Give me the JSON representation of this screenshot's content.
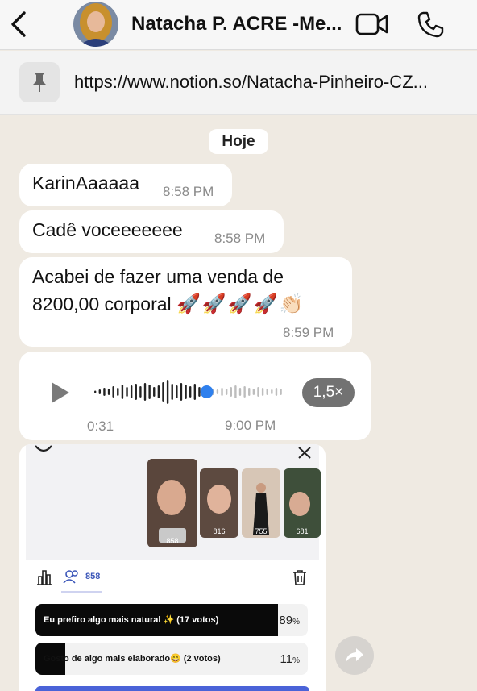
{
  "header": {
    "contact_name": "Natacha P. ACRE -Me...",
    "back_icon": "chevron-left-icon",
    "video_icon": "video-camera-icon",
    "call_icon": "phone-icon"
  },
  "pinned": {
    "icon": "pin-icon",
    "url": "https://www.notion.so/Natacha-Pinheiro-CZ..."
  },
  "date_chip": "Hoje",
  "messages": [
    {
      "text": "KarinAaaaaa",
      "time": "8:58 PM"
    },
    {
      "text": "Cadê voceeeeeee",
      "time": "8:58 PM"
    },
    {
      "line1": "Acabei de fazer uma venda de",
      "line2": "8200,00 corporal",
      "emoji": "🚀🚀🚀🚀👏🏻",
      "time": "8:59 PM"
    }
  ],
  "voice": {
    "duration": "0:31",
    "time": "9:00 PM",
    "speed": "1,5×",
    "progress": 0.6
  },
  "story": {
    "thumb_counts": [
      "858",
      "816",
      "755",
      "681"
    ],
    "viewers": "858",
    "polls": [
      {
        "label": "Eu prefiro algo mais natural ✨ (17 votos)",
        "percent": "89",
        "value": 0.89
      },
      {
        "label": "Gosto de algo mais elaborado😄 (2 votos)",
        "percent": "11",
        "value": 0.11
      }
    ],
    "pct_sign": "%"
  },
  "colors": {
    "chat_bg": "#efeae2",
    "bubble": "#ffffff",
    "accent_blue": "#3a55b8",
    "voice_progress": "#2f80ed"
  }
}
